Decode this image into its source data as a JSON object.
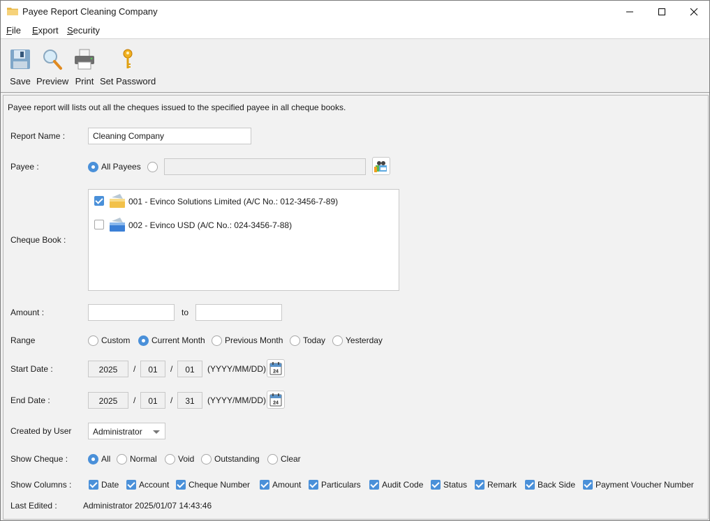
{
  "window": {
    "title": "Payee Report Cleaning Company",
    "controls": {
      "minimize": "minimize",
      "maximize": "maximize",
      "close": "close"
    }
  },
  "menu": [
    {
      "accel": "F",
      "rest": "ile"
    },
    {
      "accel": "E",
      "rest": "xport"
    },
    {
      "accel": "S",
      "rest": "ecurity"
    }
  ],
  "toolbar": {
    "save": "Save",
    "preview": "Preview",
    "print": "Print",
    "set_password": "Set Password"
  },
  "form": {
    "description": "Payee report will lists out all the cheques issued to the specified payee in all cheque books.",
    "report_name": {
      "label": "Report Name :",
      "value": "Cleaning Company"
    },
    "payee": {
      "label": "Payee :",
      "all_label": "All Payees",
      "selected": "all",
      "specific_value": ""
    },
    "cheque_book": {
      "label": "Cheque Book :",
      "items": [
        {
          "text": "001 - Evinco Solutions Limited (A/C No.: 012-3456-7-89)",
          "checked": true,
          "color": "#f0c040"
        },
        {
          "text": "002 - Evinco USD (A/C No.: 024-3456-7-88)",
          "checked": false,
          "color": "#4a8ad9"
        }
      ]
    },
    "amount": {
      "label": "Amount :",
      "from": "",
      "to_label": "to",
      "to": ""
    },
    "range": {
      "label": "Range",
      "options": [
        "Custom",
        "Current Month",
        "Previous Month",
        "Today",
        "Yesterday"
      ],
      "selected": "Current Month"
    },
    "start_date": {
      "label": "Start Date :",
      "year": "2025",
      "month": "01",
      "day": "01",
      "format": "(YYYY/MM/DD)"
    },
    "end_date": {
      "label": "End Date :",
      "year": "2025",
      "month": "01",
      "day": "31",
      "format": "(YYYY/MM/DD)"
    },
    "date_sep": "/",
    "calendar_day": "24",
    "created_by": {
      "label": "Created by User",
      "value": "Administrator"
    },
    "show_cheque": {
      "label": "Show Cheque :",
      "options": [
        "All",
        "Normal",
        "Void",
        "Outstanding",
        "Clear"
      ],
      "selected": "All"
    },
    "show_columns": {
      "label": "Show Columns :",
      "options": [
        {
          "text": "Date",
          "checked": true
        },
        {
          "text": "Account",
          "checked": true
        },
        {
          "text": "Cheque Number",
          "checked": true
        },
        {
          "text": "Amount",
          "checked": true
        },
        {
          "text": "Particulars",
          "checked": true
        },
        {
          "text": "Audit Code",
          "checked": true
        },
        {
          "text": "Status",
          "checked": true
        },
        {
          "text": "Remark",
          "checked": true
        },
        {
          "text": "Back Side",
          "checked": true
        },
        {
          "text": "Payment Voucher Number",
          "checked": true
        }
      ]
    },
    "last_edited": {
      "label": "Last Edited :",
      "value": "Administrator 2025/01/07 14:43:46"
    }
  },
  "colors": {
    "accent": "#4a90d9",
    "panel_bg": "#f2f2f2"
  }
}
